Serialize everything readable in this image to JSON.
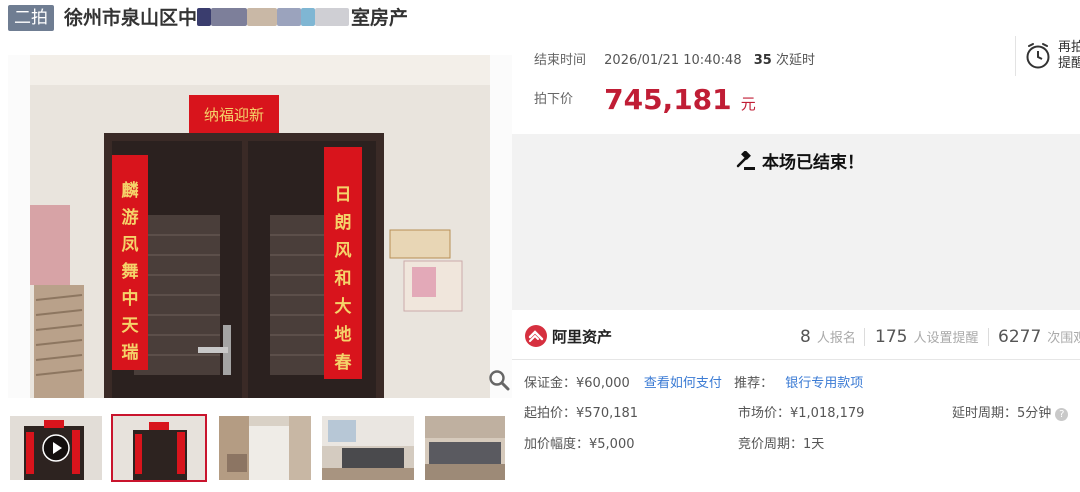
{
  "header": {
    "badge": "二拍",
    "title_start": "徐州市泉山区中",
    "title_end": "室房产"
  },
  "gallery": {
    "couplet_top": "纳福迎新",
    "couplet_left": [
      "麟",
      "游",
      "凤",
      "舞",
      "中",
      "天",
      "瑞"
    ],
    "couplet_right": [
      "日",
      "朗",
      "风",
      "和",
      "大",
      "地",
      "春"
    ],
    "thumbnail_count": 5,
    "active_thumbnail": 2
  },
  "auction": {
    "end_time_label": "结束时间",
    "end_time": "2026/01/21 10:40:48",
    "delay_count": "35",
    "delay_suffix": "次延时",
    "remind_line1": "再拍",
    "remind_line2": "提醒",
    "final_price_label": "拍下价",
    "final_price": "745,181",
    "final_price_unit": "元",
    "ended_text": "本场已结束！"
  },
  "platform": {
    "name": "阿里资产",
    "registered_count": "8",
    "registered_label": "人报名",
    "reminder_count": "175",
    "reminder_label": "人设置提醒",
    "view_count": "6277",
    "view_label": "次围观"
  },
  "details": {
    "deposit": "保证金：¥60,000",
    "how_to_pay": "查看如何支付",
    "recommend_label": "推荐：",
    "bank_loan": "银行专用款项",
    "start_price": "起拍价：¥570,181",
    "market_price": "市场价：¥1,018,179",
    "delay_period": "延时周期：5分钟",
    "increment": "加价幅度：¥5,000",
    "bid_period": "竞价周期：1天"
  },
  "colors": {
    "badge_bg": "#6f7d92",
    "price_red": "#c01d35",
    "link_blue": "#3b7bd4",
    "active_border": "#c9142d",
    "ended_bg": "#f2f2f2"
  },
  "icons": [
    "play-icon",
    "zoom-icon",
    "alarm-clock-icon",
    "gavel-icon",
    "ali-asset-logo-icon",
    "help-icon"
  ]
}
